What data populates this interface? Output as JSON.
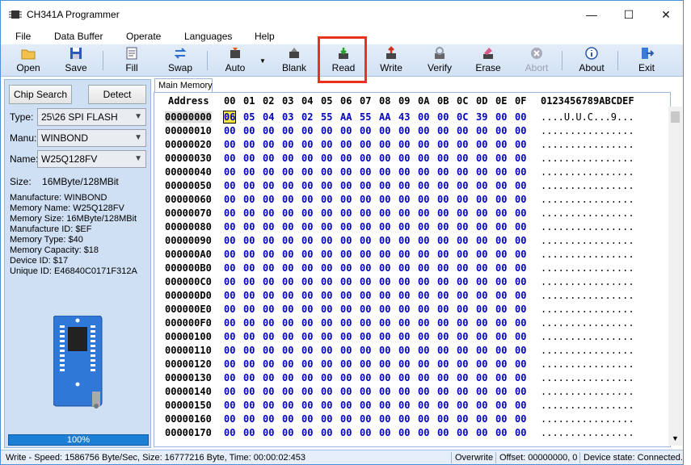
{
  "window": {
    "title": "CH341A Programmer",
    "minimize": "—",
    "maximize": "☐",
    "close": "✕"
  },
  "menu": [
    "File",
    "Data Buffer",
    "Operate",
    "Languages",
    "Help"
  ],
  "toolbar": [
    {
      "label": "Open",
      "icon": "folder-icon"
    },
    {
      "label": "Save",
      "icon": "floppy-icon"
    },
    {
      "label": "Fill",
      "icon": "fill-icon"
    },
    {
      "label": "Swap",
      "icon": "swap-icon"
    },
    {
      "label": "Auto",
      "icon": "auto-icon"
    },
    {
      "label": "Blank",
      "icon": "blank-icon"
    },
    {
      "label": "Read",
      "icon": "read-icon"
    },
    {
      "label": "Write",
      "icon": "write-icon"
    },
    {
      "label": "Verify",
      "icon": "verify-icon"
    },
    {
      "label": "Erase",
      "icon": "erase-icon"
    },
    {
      "label": "Abort",
      "icon": "abort-icon"
    },
    {
      "label": "About",
      "icon": "about-icon"
    },
    {
      "label": "Exit",
      "icon": "exit-icon"
    }
  ],
  "panel": {
    "chip_search": "Chip Search",
    "detect": "Detect",
    "type_label": "Type:",
    "type_value": "25\\26 SPI FLASH",
    "manu_label": "Manu:",
    "manu_value": "WINBOND",
    "name_label": "Name:",
    "name_value": "W25Q128FV",
    "size_line": "Size:    16MByte/128MBit",
    "info": [
      "Manufacture: WINBOND",
      "Memory Name: W25Q128FV",
      "Memory Size: 16MByte/128MBit",
      "Manufacture ID: $EF",
      "Memory Type: $40",
      "Memory Capacity: $18",
      "Device ID: $17",
      "Unique ID: E46840C0171F312A"
    ],
    "progress": "100%",
    "progress_value": 1.0
  },
  "tab": "Main Memory",
  "hex": {
    "address_header": "Address",
    "columns": [
      "00",
      "01",
      "02",
      "03",
      "04",
      "05",
      "06",
      "07",
      "08",
      "09",
      "0A",
      "0B",
      "0C",
      "0D",
      "0E",
      "0F"
    ],
    "ascii_header": "0123456789ABCDEF",
    "rows": [
      {
        "addr": "00000000",
        "bytes": [
          "06",
          "05",
          "04",
          "03",
          "02",
          "55",
          "AA",
          "55",
          "AA",
          "43",
          "00",
          "00",
          "0C",
          "39",
          "00",
          "00"
        ],
        "ascii": "....U.U.C...9..."
      },
      {
        "addr": "00000010",
        "bytes": [
          "00",
          "00",
          "00",
          "00",
          "00",
          "00",
          "00",
          "00",
          "00",
          "00",
          "00",
          "00",
          "00",
          "00",
          "00",
          "00"
        ],
        "ascii": "................"
      },
      {
        "addr": "00000020",
        "bytes": [
          "00",
          "00",
          "00",
          "00",
          "00",
          "00",
          "00",
          "00",
          "00",
          "00",
          "00",
          "00",
          "00",
          "00",
          "00",
          "00"
        ],
        "ascii": "................"
      },
      {
        "addr": "00000030",
        "bytes": [
          "00",
          "00",
          "00",
          "00",
          "00",
          "00",
          "00",
          "00",
          "00",
          "00",
          "00",
          "00",
          "00",
          "00",
          "00",
          "00"
        ],
        "ascii": "................"
      },
      {
        "addr": "00000040",
        "bytes": [
          "00",
          "00",
          "00",
          "00",
          "00",
          "00",
          "00",
          "00",
          "00",
          "00",
          "00",
          "00",
          "00",
          "00",
          "00",
          "00"
        ],
        "ascii": "................"
      },
      {
        "addr": "00000050",
        "bytes": [
          "00",
          "00",
          "00",
          "00",
          "00",
          "00",
          "00",
          "00",
          "00",
          "00",
          "00",
          "00",
          "00",
          "00",
          "00",
          "00"
        ],
        "ascii": "................"
      },
      {
        "addr": "00000060",
        "bytes": [
          "00",
          "00",
          "00",
          "00",
          "00",
          "00",
          "00",
          "00",
          "00",
          "00",
          "00",
          "00",
          "00",
          "00",
          "00",
          "00"
        ],
        "ascii": "................"
      },
      {
        "addr": "00000070",
        "bytes": [
          "00",
          "00",
          "00",
          "00",
          "00",
          "00",
          "00",
          "00",
          "00",
          "00",
          "00",
          "00",
          "00",
          "00",
          "00",
          "00"
        ],
        "ascii": "................"
      },
      {
        "addr": "00000080",
        "bytes": [
          "00",
          "00",
          "00",
          "00",
          "00",
          "00",
          "00",
          "00",
          "00",
          "00",
          "00",
          "00",
          "00",
          "00",
          "00",
          "00"
        ],
        "ascii": "................"
      },
      {
        "addr": "00000090",
        "bytes": [
          "00",
          "00",
          "00",
          "00",
          "00",
          "00",
          "00",
          "00",
          "00",
          "00",
          "00",
          "00",
          "00",
          "00",
          "00",
          "00"
        ],
        "ascii": "................"
      },
      {
        "addr": "000000A0",
        "bytes": [
          "00",
          "00",
          "00",
          "00",
          "00",
          "00",
          "00",
          "00",
          "00",
          "00",
          "00",
          "00",
          "00",
          "00",
          "00",
          "00"
        ],
        "ascii": "................"
      },
      {
        "addr": "000000B0",
        "bytes": [
          "00",
          "00",
          "00",
          "00",
          "00",
          "00",
          "00",
          "00",
          "00",
          "00",
          "00",
          "00",
          "00",
          "00",
          "00",
          "00"
        ],
        "ascii": "................"
      },
      {
        "addr": "000000C0",
        "bytes": [
          "00",
          "00",
          "00",
          "00",
          "00",
          "00",
          "00",
          "00",
          "00",
          "00",
          "00",
          "00",
          "00",
          "00",
          "00",
          "00"
        ],
        "ascii": "................"
      },
      {
        "addr": "000000D0",
        "bytes": [
          "00",
          "00",
          "00",
          "00",
          "00",
          "00",
          "00",
          "00",
          "00",
          "00",
          "00",
          "00",
          "00",
          "00",
          "00",
          "00"
        ],
        "ascii": "................"
      },
      {
        "addr": "000000E0",
        "bytes": [
          "00",
          "00",
          "00",
          "00",
          "00",
          "00",
          "00",
          "00",
          "00",
          "00",
          "00",
          "00",
          "00",
          "00",
          "00",
          "00"
        ],
        "ascii": "................"
      },
      {
        "addr": "000000F0",
        "bytes": [
          "00",
          "00",
          "00",
          "00",
          "00",
          "00",
          "00",
          "00",
          "00",
          "00",
          "00",
          "00",
          "00",
          "00",
          "00",
          "00"
        ],
        "ascii": "................"
      },
      {
        "addr": "00000100",
        "bytes": [
          "00",
          "00",
          "00",
          "00",
          "00",
          "00",
          "00",
          "00",
          "00",
          "00",
          "00",
          "00",
          "00",
          "00",
          "00",
          "00"
        ],
        "ascii": "................"
      },
      {
        "addr": "00000110",
        "bytes": [
          "00",
          "00",
          "00",
          "00",
          "00",
          "00",
          "00",
          "00",
          "00",
          "00",
          "00",
          "00",
          "00",
          "00",
          "00",
          "00"
        ],
        "ascii": "................"
      },
      {
        "addr": "00000120",
        "bytes": [
          "00",
          "00",
          "00",
          "00",
          "00",
          "00",
          "00",
          "00",
          "00",
          "00",
          "00",
          "00",
          "00",
          "00",
          "00",
          "00"
        ],
        "ascii": "................"
      },
      {
        "addr": "00000130",
        "bytes": [
          "00",
          "00",
          "00",
          "00",
          "00",
          "00",
          "00",
          "00",
          "00",
          "00",
          "00",
          "00",
          "00",
          "00",
          "00",
          "00"
        ],
        "ascii": "................"
      },
      {
        "addr": "00000140",
        "bytes": [
          "00",
          "00",
          "00",
          "00",
          "00",
          "00",
          "00",
          "00",
          "00",
          "00",
          "00",
          "00",
          "00",
          "00",
          "00",
          "00"
        ],
        "ascii": "................"
      },
      {
        "addr": "00000150",
        "bytes": [
          "00",
          "00",
          "00",
          "00",
          "00",
          "00",
          "00",
          "00",
          "00",
          "00",
          "00",
          "00",
          "00",
          "00",
          "00",
          "00"
        ],
        "ascii": "................"
      },
      {
        "addr": "00000160",
        "bytes": [
          "00",
          "00",
          "00",
          "00",
          "00",
          "00",
          "00",
          "00",
          "00",
          "00",
          "00",
          "00",
          "00",
          "00",
          "00",
          "00"
        ],
        "ascii": "................"
      },
      {
        "addr": "00000170",
        "bytes": [
          "00",
          "00",
          "00",
          "00",
          "00",
          "00",
          "00",
          "00",
          "00",
          "00",
          "00",
          "00",
          "00",
          "00",
          "00",
          "00"
        ],
        "ascii": "................"
      }
    ]
  },
  "status": {
    "speed": "Write - Speed: 1586756 Byte/Sec, Size: 16777216 Byte, Time: 00:00:02:453",
    "mode": "Overwrite",
    "offset": "Offset: 00000000, 0",
    "device": "Device state: Connected."
  },
  "colors": {
    "accent": "#1d7ed6",
    "highlight": "#e8341c",
    "hex_bytes": "#0000c0"
  }
}
